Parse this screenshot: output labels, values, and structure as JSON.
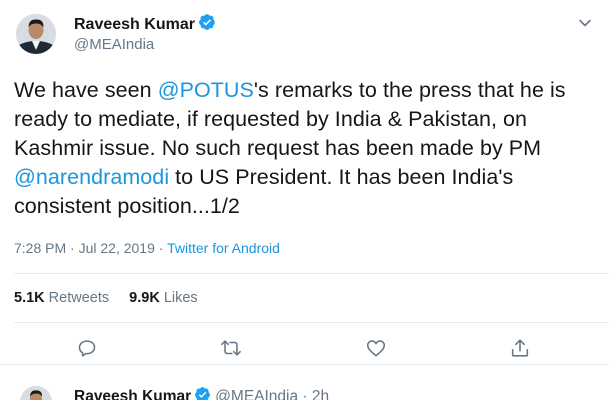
{
  "tweet": {
    "author": {
      "display_name": "Raveesh Kumar",
      "handle": "@MEAIndia",
      "verified": true
    },
    "text_parts": [
      "We have seen ",
      "@POTUS",
      "'s remarks to the press that he is ready to mediate, if requested by India & Pakistan, on Kashmir issue. No such request has been made by PM ",
      "@narendramodi",
      " to US President. It has been India's consistent position...1/2"
    ],
    "time": "7:28 PM",
    "separator": " · ",
    "date": "Jul 22, 2019",
    "source": "Twitter for Android",
    "retweets_count": "5.1K",
    "retweets_label": "Retweets",
    "likes_count": "9.9K",
    "likes_label": "Likes"
  },
  "actions": {
    "icons": [
      "reply-icon",
      "retweet-icon",
      "like-icon",
      "share-icon"
    ]
  },
  "next_tweet": {
    "display_name": "Raveesh Kumar",
    "handle_time": "@MEAIndia · 2h"
  },
  "colors": {
    "link": "#1b95e0",
    "secondary_text": "#657786",
    "primary_text": "#14171a",
    "verified": "#1da1f2",
    "border": "#e6ecf0"
  }
}
